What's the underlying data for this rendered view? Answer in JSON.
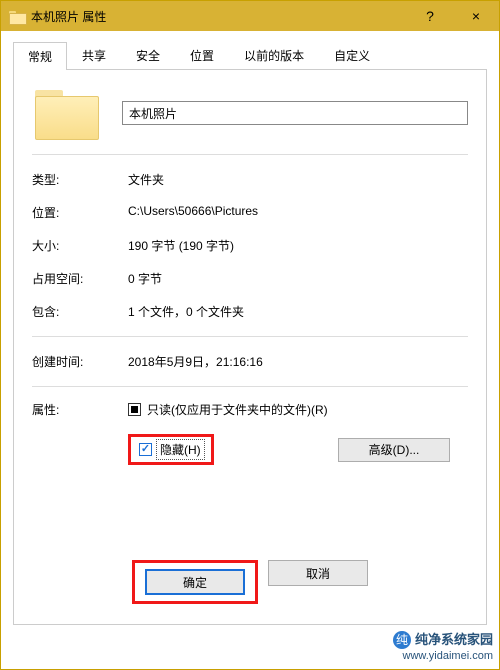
{
  "window": {
    "title": "本机照片 属性",
    "help_glyph": "?",
    "close_glyph": "×"
  },
  "tabs": {
    "items": [
      {
        "label": "常规"
      },
      {
        "label": "共享"
      },
      {
        "label": "安全"
      },
      {
        "label": "位置"
      },
      {
        "label": "以前的版本"
      },
      {
        "label": "自定义"
      }
    ],
    "active_index": 0
  },
  "general": {
    "folder_name": "本机照片",
    "type_label": "类型:",
    "type_value": "文件夹",
    "location_label": "位置:",
    "location_value": "C:\\Users\\50666\\Pictures",
    "size_label": "大小:",
    "size_value": "190 字节 (190 字节)",
    "diskspace_label": "占用空间:",
    "diskspace_value": "0 字节",
    "contains_label": "包含:",
    "contains_value": "1 个文件，0 个文件夹",
    "created_label": "创建时间:",
    "created_value": "2018年5月9日，21:16:16",
    "attr_label": "属性:",
    "readonly_label": "只读(仅应用于文件夹中的文件)(R)",
    "hidden_label": "隐藏(H)",
    "advanced_label": "高级(D)..."
  },
  "state": {
    "readonly": "indeterminate",
    "hidden": true
  },
  "buttons": {
    "ok": "确定",
    "cancel": "取消"
  },
  "watermark": {
    "line1": "纯净系统家园",
    "line2": "www.yidaimei.com",
    "bubble": "纯"
  }
}
